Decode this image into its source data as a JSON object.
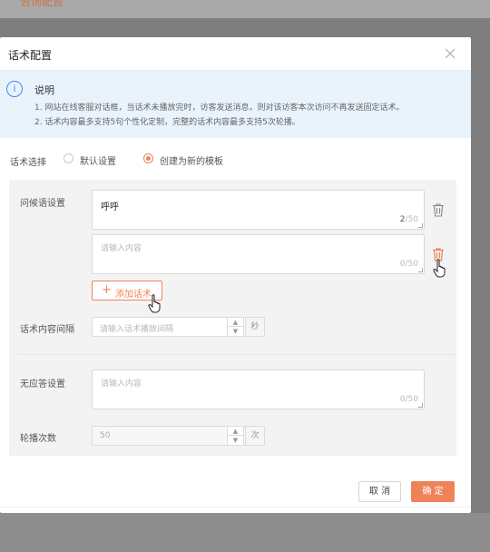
{
  "background": {
    "title": "咨询配置"
  },
  "dialog": {
    "title": "话术配置"
  },
  "notice": {
    "icon_text": "i",
    "title": "说明",
    "lines": [
      "1. 网站在线客服对话框，当话术未播放完时，访客发送消息，则对该访客本次访问不再发送固定话术。",
      "2. 话术内容最多支持5句个性化定制，完整的话术内容最多支持5次轮播。"
    ]
  },
  "script_choice": {
    "label": "话术选择",
    "options": [
      {
        "label": "默认设置",
        "selected": false
      },
      {
        "label": "创建为新的模板",
        "selected": true
      }
    ]
  },
  "greeting": {
    "label": "问候语设置",
    "items": [
      {
        "value": "呼呼",
        "count": "2",
        "max": "/50"
      },
      {
        "placeholder": "请输入内容",
        "count": "0/50"
      }
    ],
    "add_label": "添加话术"
  },
  "interval": {
    "label": "话术内容间隔",
    "placeholder": "请输入话术播放间隔",
    "unit": "秒"
  },
  "no_reply": {
    "label": "无应答设置",
    "placeholder": "请输入内容",
    "count": "0/50"
  },
  "rotation": {
    "label": "轮播次数",
    "value": "50",
    "unit": "次"
  },
  "footer": {
    "cancel_label": "取 消",
    "ok_label": "确 定"
  },
  "colors": {
    "accent": "#f0825a",
    "info": "#3c8ee6",
    "notice_bg": "#e9f3fc"
  }
}
